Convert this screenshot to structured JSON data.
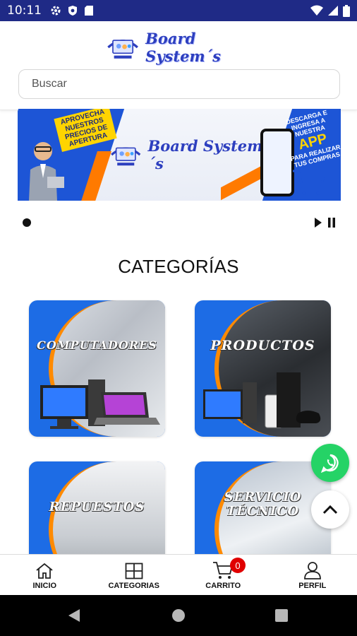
{
  "status_bar": {
    "time": "10:11"
  },
  "header": {
    "logo_text": "Board System´s",
    "search_placeholder": "Buscar"
  },
  "banner": {
    "left_text": "APROVECHA NUESTROS PRECIOS DE APERTURA",
    "logo_text": "Board System´s",
    "right_text_top": "DESCARGA E INGRESA A NUESTRA",
    "right_text_app": "APP",
    "right_text_bottom": "PARA REALIZAR TUS COMPRAS"
  },
  "section_title": "CATEGORÍAS",
  "categories": [
    {
      "label": "COMPUTADORES"
    },
    {
      "label": "PRODUCTOS"
    },
    {
      "label": "REPUESTOS"
    },
    {
      "label_line1": "SERVICIO",
      "label_line2": "TÉCNICO"
    }
  ],
  "bottom_nav": {
    "items": [
      {
        "label": "INICIO",
        "icon": "home-icon"
      },
      {
        "label": "CATEGORIAS",
        "icon": "grid-icon"
      },
      {
        "label": "CARRITO",
        "icon": "cart-icon"
      },
      {
        "label": "PERFIL",
        "icon": "user-icon"
      }
    ],
    "cart_count": "0"
  },
  "colors": {
    "status_bar": "#1f2a86",
    "brand_blue": "#1d6ce5",
    "accent_orange": "#ff8a00",
    "whatsapp_green": "#25d366",
    "badge_red": "#e00000"
  }
}
